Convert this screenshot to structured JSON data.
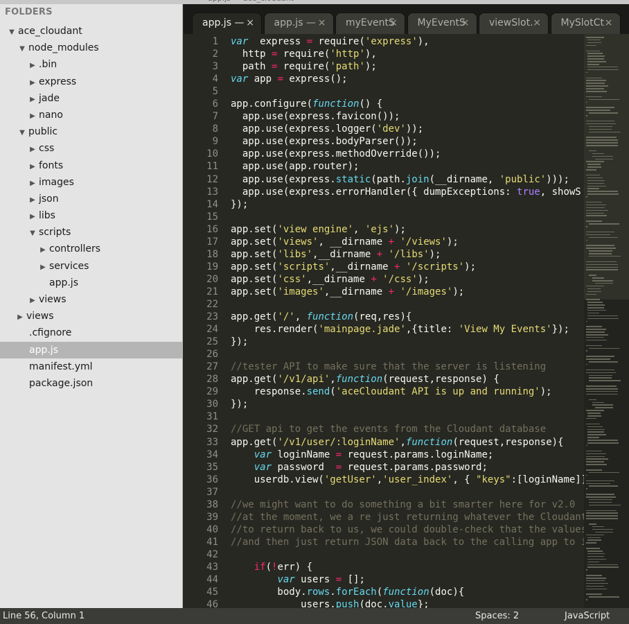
{
  "sidebar": {
    "header": "FOLDERS",
    "tree": [
      {
        "label": "ace_cloudant",
        "level": 0,
        "arrow": "▼"
      },
      {
        "label": "node_modules",
        "level": 1,
        "arrow": "▼"
      },
      {
        "label": ".bin",
        "level": 2,
        "arrow": "▶"
      },
      {
        "label": "express",
        "level": 2,
        "arrow": "▶"
      },
      {
        "label": "jade",
        "level": 2,
        "arrow": "▶"
      },
      {
        "label": "nano",
        "level": 2,
        "arrow": "▶"
      },
      {
        "label": "public",
        "level": 1,
        "arrow": "▼"
      },
      {
        "label": "css",
        "level": 2,
        "arrow": "▶"
      },
      {
        "label": "fonts",
        "level": 2,
        "arrow": "▶"
      },
      {
        "label": "images",
        "level": 2,
        "arrow": "▶"
      },
      {
        "label": "json",
        "level": 2,
        "arrow": "▶"
      },
      {
        "label": "libs",
        "level": 2,
        "arrow": "▶"
      },
      {
        "label": "scripts",
        "level": 2,
        "arrow": "▼"
      },
      {
        "label": "controllers",
        "level": 3,
        "arrow": "▶"
      },
      {
        "label": "services",
        "level": 3,
        "arrow": "▶"
      },
      {
        "label": "app.js",
        "level": 3,
        "arrow": ""
      },
      {
        "label": "views",
        "level": 2,
        "arrow": "▶"
      },
      {
        "label": "views",
        "level": 1,
        "arrow": "▶",
        "indent_override": 0
      },
      {
        "label": ".cfignore",
        "level": 1,
        "arrow": "",
        "file": true
      },
      {
        "label": "app.js",
        "level": 1,
        "arrow": "",
        "file": true,
        "selected": true
      },
      {
        "label": "manifest.yml",
        "level": 1,
        "arrow": "",
        "file": true
      },
      {
        "label": "package.json",
        "level": 1,
        "arrow": "",
        "file": true
      }
    ]
  },
  "tabs": [
    {
      "label": "app.js —",
      "active": true
    },
    {
      "label": "app.js —",
      "active": false
    },
    {
      "label": "myEventS",
      "active": false
    },
    {
      "label": "MyEventS",
      "active": false
    },
    {
      "label": "viewSlot.",
      "active": false
    },
    {
      "label": "MySlotCt",
      "active": false
    }
  ],
  "tab_close_glyph": "×",
  "editor": {
    "start_line": 1,
    "lines": [
      [
        [
          "kw",
          "var"
        ],
        [
          "",
          "  express "
        ],
        [
          "op",
          "="
        ],
        [
          "",
          " require("
        ],
        [
          "str",
          "'express'"
        ],
        [
          "",
          "),"
        ]
      ],
      [
        [
          "",
          "  http "
        ],
        [
          "op",
          "="
        ],
        [
          "",
          " require("
        ],
        [
          "str",
          "'http'"
        ],
        [
          "",
          "),"
        ]
      ],
      [
        [
          "",
          "  path "
        ],
        [
          "op",
          "="
        ],
        [
          "",
          " require("
        ],
        [
          "str",
          "'path'"
        ],
        [
          "",
          "); "
        ]
      ],
      [
        [
          "kw",
          "var"
        ],
        [
          "",
          " app "
        ],
        [
          "op",
          "="
        ],
        [
          "",
          " express();"
        ]
      ],
      [],
      [
        [
          "",
          "app.configure("
        ],
        [
          "fn",
          "function"
        ],
        [
          "",
          "() {"
        ]
      ],
      [
        [
          "",
          "  app.use(express.favicon());"
        ]
      ],
      [
        [
          "",
          "  app.use(express.logger("
        ],
        [
          "str",
          "'dev'"
        ],
        [
          "",
          "));"
        ]
      ],
      [
        [
          "",
          "  app.use(express.bodyParser());"
        ]
      ],
      [
        [
          "",
          "  app.use(express.methodOverride());"
        ]
      ],
      [
        [
          "",
          "  app.use(app.router);"
        ]
      ],
      [
        [
          "",
          "  app.use(express."
        ],
        [
          "bi",
          "static"
        ],
        [
          "",
          "(path."
        ],
        [
          "bi",
          "join"
        ],
        [
          "",
          "(__dirname, "
        ],
        [
          "str",
          "'public'"
        ],
        [
          "",
          ")));"
        ]
      ],
      [
        [
          "",
          "  app.use(express.errorHandler({ dumpExceptions: "
        ],
        [
          "bool",
          "true"
        ],
        [
          "",
          ", showS"
        ]
      ],
      [
        [
          "",
          "});"
        ]
      ],
      [],
      [
        [
          "",
          "app.set("
        ],
        [
          "str",
          "'view engine'"
        ],
        [
          "",
          ", "
        ],
        [
          "str",
          "'ejs'"
        ],
        [
          "",
          ");"
        ]
      ],
      [
        [
          "",
          "app.set("
        ],
        [
          "str",
          "'views'"
        ],
        [
          "",
          ", __dirname "
        ],
        [
          "op",
          "+"
        ],
        [
          "",
          ""
        ],
        [
          "str",
          " '/views'"
        ],
        [
          "",
          ");"
        ]
      ],
      [
        [
          "",
          "app.set("
        ],
        [
          "str",
          "'libs'"
        ],
        [
          "",
          ",__dirname "
        ],
        [
          "op",
          "+"
        ],
        [
          "str",
          " '/libs'"
        ],
        [
          "",
          ");"
        ]
      ],
      [
        [
          "",
          "app.set("
        ],
        [
          "str",
          "'scripts'"
        ],
        [
          "",
          ",__dirname "
        ],
        [
          "op",
          "+"
        ],
        [
          "str",
          " '/scripts'"
        ],
        [
          "",
          ");"
        ]
      ],
      [
        [
          "",
          "app.set("
        ],
        [
          "str",
          "'css'"
        ],
        [
          "",
          ",__dirname "
        ],
        [
          "op",
          "+"
        ],
        [
          "str",
          " '/css'"
        ],
        [
          "",
          ");"
        ]
      ],
      [
        [
          "",
          "app.set("
        ],
        [
          "str",
          "'images'"
        ],
        [
          "",
          ",__dirname "
        ],
        [
          "op",
          "+"
        ],
        [
          "str",
          " '/images'"
        ],
        [
          "",
          ");"
        ]
      ],
      [],
      [
        [
          "",
          "app.get("
        ],
        [
          "str",
          "'/'"
        ],
        [
          "",
          ", "
        ],
        [
          "fn",
          "function"
        ],
        [
          "",
          "(req,res){"
        ]
      ],
      [
        [
          "",
          "    res.render("
        ],
        [
          "str",
          "'mainpage.jade'"
        ],
        [
          "",
          ",{title: "
        ],
        [
          "str",
          "'View My Events'"
        ],
        [
          "",
          "});"
        ]
      ],
      [
        [
          "",
          "});"
        ]
      ],
      [],
      [
        [
          "cm",
          "//tester API to make sure that the server is listening"
        ]
      ],
      [
        [
          "",
          "app.get("
        ],
        [
          "str",
          "'/v1/api'"
        ],
        [
          "",
          ","
        ],
        [
          "fn",
          "function"
        ],
        [
          "",
          "(request,response) {"
        ]
      ],
      [
        [
          "",
          "    response."
        ],
        [
          "bi",
          "send"
        ],
        [
          "",
          "("
        ],
        [
          "str",
          "'aceCloudant API is up and running'"
        ],
        [
          "",
          ");"
        ]
      ],
      [
        [
          "",
          "});"
        ]
      ],
      [],
      [
        [
          "cm",
          "//GET api to get the events from the Cloudant database"
        ]
      ],
      [
        [
          "",
          "app.get("
        ],
        [
          "str",
          "'/v1/user/:loginName'"
        ],
        [
          "",
          ","
        ],
        [
          "fn",
          "function"
        ],
        [
          "",
          "(request,response){"
        ]
      ],
      [
        [
          "",
          "    "
        ],
        [
          "kw",
          "var"
        ],
        [
          "",
          " loginName "
        ],
        [
          "op",
          "="
        ],
        [
          "",
          " request.params.loginName;"
        ]
      ],
      [
        [
          "",
          "    "
        ],
        [
          "kw",
          "var"
        ],
        [
          "",
          " password  "
        ],
        [
          "op",
          "="
        ],
        [
          "",
          " request.params.password;"
        ]
      ],
      [
        [
          "",
          "    userdb.view("
        ],
        [
          "str",
          "'getUser'"
        ],
        [
          "",
          ","
        ],
        [
          "str",
          "'user_index'"
        ],
        [
          "",
          ", { "
        ],
        [
          "str",
          "\"keys\""
        ],
        [
          "",
          ":[loginName]]"
        ]
      ],
      [],
      [
        [
          "cm",
          "//we might want to do something a bit smarter here for v2.0"
        ]
      ],
      [
        [
          "cm",
          "//at the moment, we a re just returning whatever the Cloudant"
        ]
      ],
      [
        [
          "cm",
          "//to return back to us, we could double-check that the values"
        ]
      ],
      [
        [
          "cm",
          "//and then just return JSON data back to the calling app to i"
        ]
      ],
      [],
      [
        [
          "",
          "    "
        ],
        [
          "op",
          "if"
        ],
        [
          "",
          "("
        ],
        [
          "op",
          "!"
        ],
        [
          "",
          "err) {"
        ]
      ],
      [
        [
          "",
          "        "
        ],
        [
          "kw",
          "var"
        ],
        [
          "",
          " users "
        ],
        [
          "op",
          "="
        ],
        [
          "",
          " [];"
        ]
      ],
      [
        [
          "",
          "        body."
        ],
        [
          "bi",
          "rows"
        ],
        [
          "",
          "."
        ],
        [
          "bi",
          "forEach"
        ],
        [
          "",
          "("
        ],
        [
          "fn",
          "function"
        ],
        [
          "",
          "(doc){"
        ]
      ],
      [
        [
          "",
          "            users."
        ],
        [
          "bi",
          "push"
        ],
        [
          "",
          "(doc."
        ],
        [
          "bi",
          "value"
        ],
        [
          "",
          "};"
        ]
      ]
    ]
  },
  "statusbar": {
    "position": "Line 56, Column 1",
    "spaces": "Spaces: 2",
    "syntax": "JavaScript"
  },
  "colors": {
    "editor_bg": "#272822",
    "keyword": "#66d9ef",
    "string": "#e6db74",
    "operator": "#f92672",
    "comment": "#75715e",
    "constant": "#ae81ff"
  }
}
